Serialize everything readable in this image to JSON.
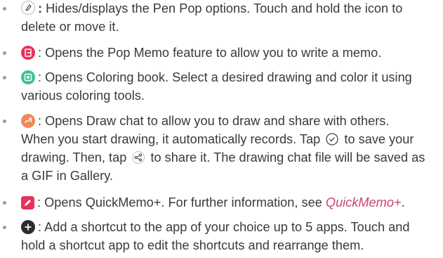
{
  "colors": {
    "text": "#3a3a3a",
    "bullet": "#9a9a9a",
    "link": "#c8456e",
    "pop_memo_icon": "#e8325a",
    "coloring_book_icon": "#3fbf9a",
    "draw_chat_icon": "#f08a5a",
    "quickmemo_icon": "#e8325a",
    "add_shortcut_icon": "#2b2b2b"
  },
  "items": [
    {
      "icon": "pen-pop-toggle-icon",
      "sep": ":",
      "lines": [
        "Hides/displays the Pen Pop options. Touch and hold the icon to",
        "delete or move it."
      ]
    },
    {
      "icon": "pop-memo-icon",
      "lines": [
        ": Opens the Pop Memo feature to allow you to write a memo."
      ]
    },
    {
      "icon": "coloring-book-icon",
      "lines": [
        ": Opens Coloring book. Select a desired drawing and color it using",
        "various coloring tools."
      ]
    },
    {
      "icon": "draw-chat-icon",
      "lines": [
        ": Opens Draw chat to allow you to draw and share with others.",
        "When you start drawing, it automatically records. Tap",
        "to save your",
        "drawing. Then, tap",
        "to share it. The drawing chat file will be saved as",
        "a GIF in Gallery."
      ]
    },
    {
      "icon": "quickmemo-icon",
      "lines": [
        ": Opens QuickMemo+. For further information, see",
        "QuickMemo+",
        "."
      ]
    },
    {
      "icon": "add-shortcut-icon",
      "lines": [
        ": Add a shortcut to the app of your choice up to 5 apps. Touch and",
        "hold a shortcut app to edit the shortcuts and rearrange them."
      ]
    }
  ],
  "inline_icons": {
    "save": "check-circle-icon",
    "share": "share-icon"
  }
}
